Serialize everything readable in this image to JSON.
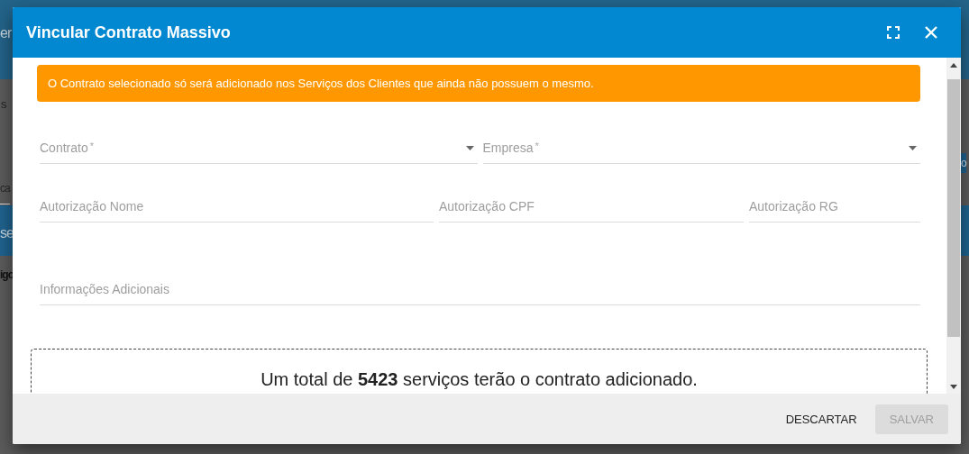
{
  "background": {
    "fragments": [
      {
        "text": "er",
        "kind": "heading"
      },
      {
        "text": "s",
        "kind": "plain"
      },
      {
        "text": "ca",
        "kind": "field"
      },
      {
        "text": "se",
        "kind": "heading"
      },
      {
        "text": "igo",
        "kind": "bold"
      },
      {
        "text": "o",
        "kind": "button"
      }
    ]
  },
  "dialog": {
    "title": "Vincular Contrato Massivo",
    "alert": "O Contrato selecionado só será adicionado nos Serviços dos Clientes que ainda não possuem o mesmo.",
    "field_rows": [
      [
        {
          "kind": "select",
          "label": "Contrato",
          "required": true
        },
        {
          "kind": "select",
          "label": "Empresa",
          "required": true
        }
      ],
      [
        {
          "kind": "input",
          "label": "Autorização Nome",
          "required": false
        },
        {
          "kind": "input",
          "label": "Autorização CPF",
          "required": false
        },
        {
          "kind": "input",
          "label": "Autorização RG",
          "required": false
        }
      ],
      [
        {
          "kind": "input",
          "label": "Informações Adicionais",
          "required": false
        }
      ]
    ],
    "required_mark": "*",
    "summary": "Um total de **5423** serviços terão o contrato adicionado.",
    "buttons": [
      {
        "label": "DESCARTAR",
        "disabled": false
      },
      {
        "label": "SALVAR",
        "disabled": true
      }
    ]
  }
}
